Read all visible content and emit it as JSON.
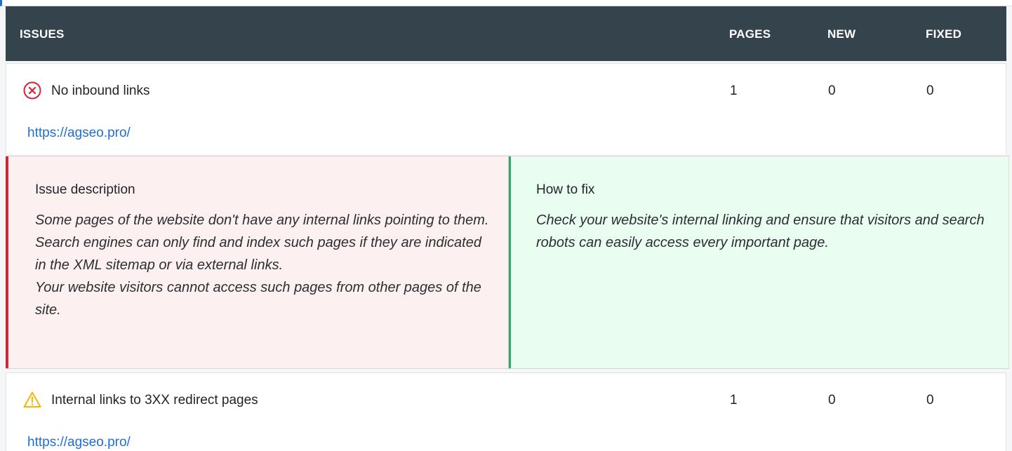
{
  "table_header": {
    "issues_label": "ISSUES",
    "pages_label": "PAGES",
    "new_label": "NEW",
    "fixed_label": "FIXED"
  },
  "issues": [
    {
      "icon": "error-circle-icon",
      "icon_color": "#d0273b",
      "title": "No inbound links",
      "pages": "1",
      "new": "0",
      "fixed": "0",
      "url": "https://agseo.pro/",
      "description_title": "Issue description",
      "description_lines": [
        "Some pages of the website don't have any internal links pointing to them.",
        "Search engines can only find and index such pages if they are indicated in the XML sitemap or via external links.",
        "Your website visitors cannot access such pages from other pages of the site."
      ],
      "fix_title": "How to fix",
      "fix_text": "Check your website's internal linking and ensure that visitors and search robots can easily access every important page."
    },
    {
      "icon": "warning-triangle-icon",
      "icon_color": "#f2b705",
      "title": "Internal links to 3XX redirect pages",
      "pages": "1",
      "new": "0",
      "fixed": "0",
      "url": "https://agseo.pro/"
    }
  ],
  "colors": {
    "header_bg": "#35434d",
    "link": "#1f6fd1",
    "error_accent": "#d0273b",
    "error_bg": "#fdf0f0",
    "success_accent": "#2eaa6b",
    "success_bg": "#eafdf1"
  }
}
